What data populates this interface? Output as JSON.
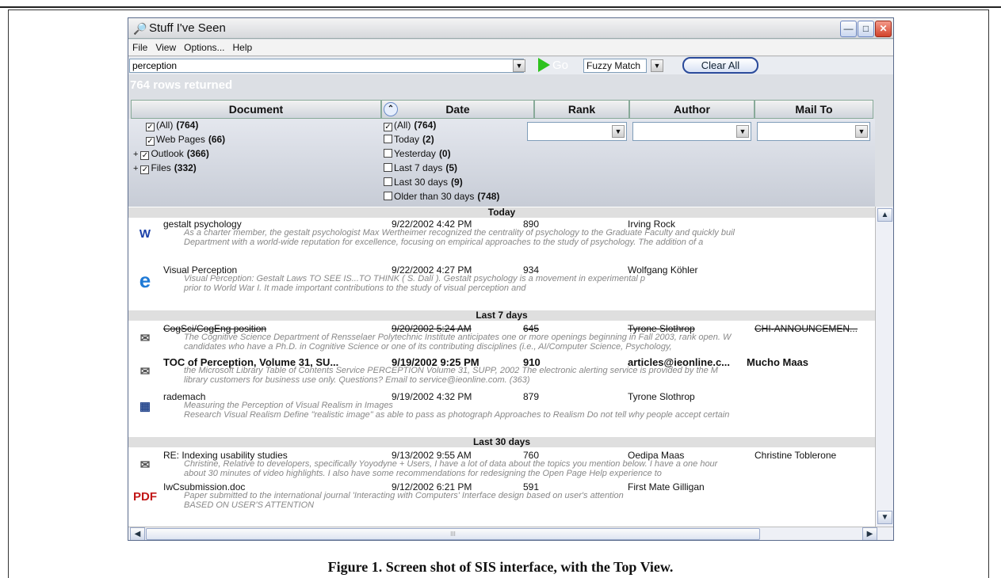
{
  "window": {
    "title": "Stuff I've Seen"
  },
  "menu": [
    "File",
    "View",
    "Options...",
    "Help"
  ],
  "search": {
    "value": "perception",
    "go_label": "Go",
    "match_mode": "Fuzzy Match",
    "clear_label": "Clear All"
  },
  "status": "764 rows returned",
  "columns": [
    "Document",
    "Date",
    "Rank",
    "Author",
    "Mail To"
  ],
  "filters": {
    "document": [
      {
        "label": "(All)",
        "count": "(764)",
        "checked": true,
        "expander": false
      },
      {
        "label": "Web Pages",
        "count": "(66)",
        "checked": true,
        "expander": false
      },
      {
        "label": "Outlook",
        "count": "(366)",
        "checked": true,
        "expander": true
      },
      {
        "label": "Files",
        "count": "(332)",
        "checked": true,
        "expander": true
      }
    ],
    "date": [
      {
        "label": "(All)",
        "count": "(764)",
        "checked": true
      },
      {
        "label": "Today",
        "count": "(2)",
        "checked": false
      },
      {
        "label": "Yesterday",
        "count": "(0)",
        "checked": false
      },
      {
        "label": "Last 7 days",
        "count": "(5)",
        "checked": false
      },
      {
        "label": "Last 30 days",
        "count": "(9)",
        "checked": false
      },
      {
        "label": "Older than 30 days",
        "count": "(748)",
        "checked": false
      }
    ]
  },
  "groups": {
    "today": "Today",
    "last7": "Last 7 days",
    "last30": "Last 30 days"
  },
  "rows": [
    {
      "icon": "word-doc-icon",
      "title": "gestalt psychology",
      "date": "9/22/2002 4:42 PM",
      "rank": "890",
      "author": "Irving Rock",
      "mailto": "",
      "s1": "As a charter member, the gestalt psychologist Max Wertheimer recognized the centrality of psychology to the Graduate Faculty and quickly buil",
      "s2": "Department with a world-wide reputation for excellence, focusing on empirical approaches to the study of psychology. The addition of a"
    },
    {
      "icon": "web-page-icon",
      "title": "Visual Perception",
      "date": "9/22/2002 4:27 PM",
      "rank": "934",
      "author": "Wolfgang Köhler",
      "mailto": "",
      "s1": "Visual        Perception: Gestalt Laws TO SEE IS...TO THINK ( S.         Dalí ). Gestalt psychology          is a movement in experimental p",
      "s2": "prior to World         War I. It made important contributions to the study of visual perception         and"
    },
    {
      "icon": "mail-icon",
      "title": "CogSci/CogEng position",
      "date": "9/20/2002 5:24 AM",
      "rank": "645",
      "author": "Tyrone Slothrop",
      "mailto": "CHI-ANNOUNCEMEN...",
      "s1": "The Cognitive Science Department of Rensselaer Polytechnic Institute  anticipates one or more openings beginning in Fall 2003, rank open.  W",
      "s2": "candidates who have a Ph.D. in Cognitive Science or  one of its contributing disciplines (i.e., AI/Computer Science,  Psychology,"
    },
    {
      "icon": "mail-icon",
      "title": "TOC of Perception, Volume 31, SU...",
      "date": "9/19/2002 9:25 PM",
      "rank": "910",
      "author": "articles@ieonline.c...",
      "mailto": "Mucho Maas",
      "s1": "the Microsoft Library Table of Contents Service   PERCEPTION  Volume 31, SUPP, 2002    The electronic alerting service is provided by the M",
      "s2": "library customers for business use only.   Questions? Email to service@ieonline.com. (363)"
    },
    {
      "icon": "image-icon",
      "title": "rademach",
      "date": "9/19/2002 4:32 PM",
      "rank": "879",
      "author": "Tyrone Slothrop",
      "mailto": "",
      "s1": "Measuring the Perception of Visual Realism in Images",
      "s2": "Research Visual Realism Define \"realistic image\" as able to pass as photograph  Approaches to Realism Do not tell why people accept certain"
    },
    {
      "icon": "mail-icon",
      "title": "RE: Indexing usability studies",
      "date": "9/13/2002 9:55 AM",
      "rank": "760",
      "author": "Oedipa Maas",
      "mailto": "Christine Toblerone",
      "s1": "Christine,    Relative to developers, specifically Yoyodyne + Users, I have a lot of data about the topics you mention below. I have a one hour",
      "s2": "about 30 minutes of video highlights. I also have some recommendations for redesigning the  Open Page  Help experience to"
    },
    {
      "icon": "pdf-icon",
      "title": "IwCsubmission.doc",
      "date": "9/12/2002 6:21 PM",
      "rank": "591",
      "author": "First Mate Gilligan",
      "mailto": "",
      "s1": "Paper submitted to the international journal 'Interacting with Computers'                                    Interface design based on user's attention",
      "s2": "BASED ON USER'S ATTENTION"
    }
  ],
  "hscroll_grip": "III",
  "caption": "Figure 1. Screen shot of SIS interface, with the Top View."
}
